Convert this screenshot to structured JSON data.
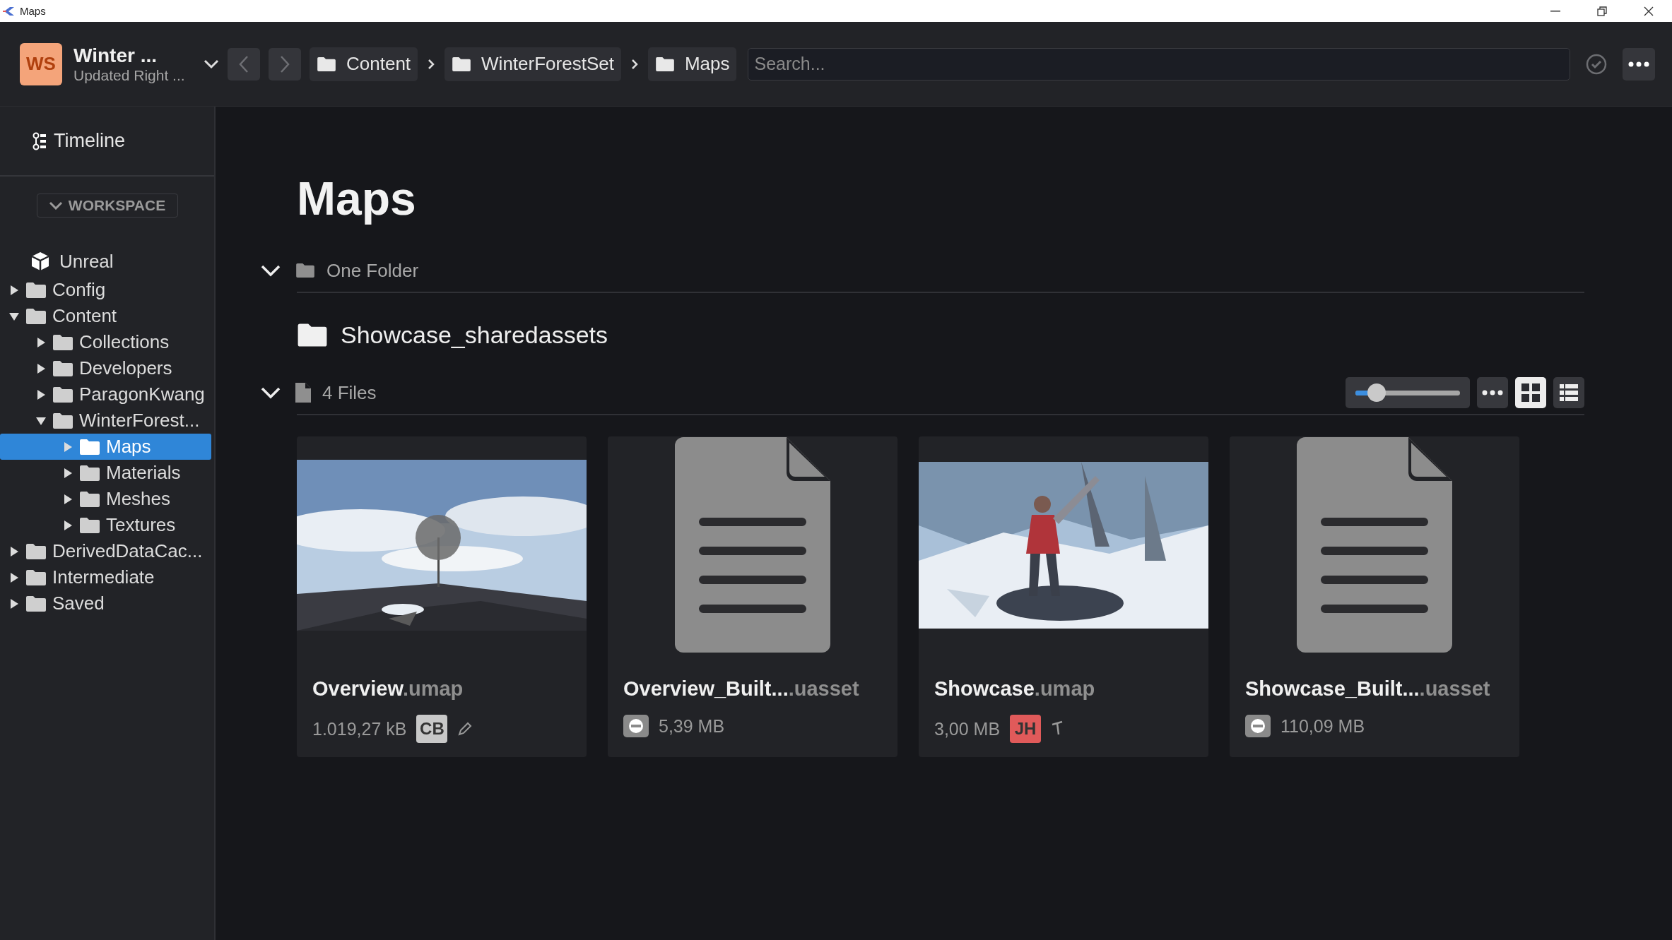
{
  "window": {
    "title": "Maps"
  },
  "workspace": {
    "initials": "WS",
    "name": "Winter ...",
    "subtitle": "Updated Right ..."
  },
  "breadcrumbs": [
    "Content",
    "WinterForestSet",
    "Maps"
  ],
  "search": {
    "placeholder": "Search..."
  },
  "sidebar": {
    "timeline": "Timeline",
    "section": "WORKSPACE",
    "tree": {
      "label": "Unreal",
      "children": [
        {
          "label": "Config",
          "expanded": false,
          "selected": false
        },
        {
          "label": "Content",
          "expanded": true,
          "selected": false,
          "children": [
            {
              "label": "Collections",
              "expanded": false,
              "selected": false
            },
            {
              "label": "Developers",
              "expanded": false,
              "selected": false
            },
            {
              "label": "ParagonKwang",
              "expanded": false,
              "selected": false
            },
            {
              "label": "WinterForest...",
              "expanded": true,
              "selected": false,
              "children": [
                {
                  "label": "Maps",
                  "expanded": false,
                  "selected": true
                },
                {
                  "label": "Materials",
                  "expanded": false,
                  "selected": false
                },
                {
                  "label": "Meshes",
                  "expanded": false,
                  "selected": false
                },
                {
                  "label": "Textures",
                  "expanded": false,
                  "selected": false
                }
              ]
            }
          ]
        },
        {
          "label": "DerivedDataCac...",
          "expanded": false,
          "selected": false
        },
        {
          "label": "Intermediate",
          "expanded": false,
          "selected": false
        },
        {
          "label": "Saved",
          "expanded": false,
          "selected": false
        }
      ]
    }
  },
  "page": {
    "title": "Maps"
  },
  "folders_section": {
    "label": "One Folder",
    "expanded": true,
    "folders": [
      "Showcase_sharedassets"
    ]
  },
  "files_section": {
    "label": "4 Files",
    "expanded": true,
    "size_slider": {
      "level": 0.2
    },
    "views": [
      {
        "kind": "grid",
        "selected": true
      },
      {
        "kind": "list",
        "selected": false
      }
    ],
    "files": [
      {
        "kind": "picture",
        "name": "Overview",
        "ext": ".umap",
        "size": "1.019,27 kB",
        "owner": {
          "initials": "CB",
          "color": "#c8c8c8"
        },
        "editing": true
      },
      {
        "kind": "document",
        "name": "Overview_Built...",
        "ext": ".uasset",
        "size": "5,39 MB"
      },
      {
        "kind": "picture",
        "name": "Showcase",
        "ext": ".umap",
        "size": "3,00 MB",
        "owner": {
          "initials": "JH",
          "color": "#e05a5a"
        },
        "pinned": true
      },
      {
        "kind": "document",
        "name": "Showcase_Built...",
        "ext": ".uasset",
        "size": "110,09 MB"
      }
    ]
  }
}
